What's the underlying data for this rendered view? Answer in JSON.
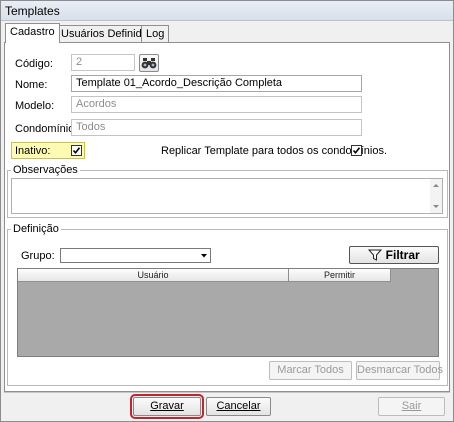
{
  "window": {
    "title": "Templates"
  },
  "tabs": [
    {
      "label": "Cadastro",
      "active": true
    },
    {
      "label": "Usuários Definidos",
      "active": false
    },
    {
      "label": "Log",
      "active": false
    }
  ],
  "form": {
    "codigo": {
      "label": "Código:",
      "value": "2"
    },
    "nome": {
      "label": "Nome:",
      "value": "Template 01_Acordo_Descrição Completa"
    },
    "modelo": {
      "label": "Modelo:",
      "value": "Acordos"
    },
    "condominio": {
      "label": "Condomínio:",
      "value": "Todos"
    },
    "inativo": {
      "label": "Inativo:",
      "checked": true
    },
    "replicar": {
      "label": "Replicar Template para todos os condomínios.",
      "checked": true
    }
  },
  "observacoes": {
    "title": "Observações",
    "value": ""
  },
  "definicao": {
    "title": "Definição",
    "grupo_label": "Grupo:",
    "grupo_value": "",
    "filtrar_label": "Filtrar",
    "columns": [
      "Usuário",
      "Permitir"
    ],
    "rows": [],
    "marcar_todos": "Marcar Todos",
    "desmarcar_todos": "Desmarcar Todos"
  },
  "footer": {
    "gravar": "Gravar",
    "cancelar": "Cancelar",
    "sair": "Sair"
  },
  "colors": {
    "highlight": "#fdfbb3",
    "focus_border": "#c0262d",
    "grid_background": "#a9a9a9"
  },
  "icons": {
    "search": "binoculars-icon",
    "filter": "funnel-icon"
  }
}
